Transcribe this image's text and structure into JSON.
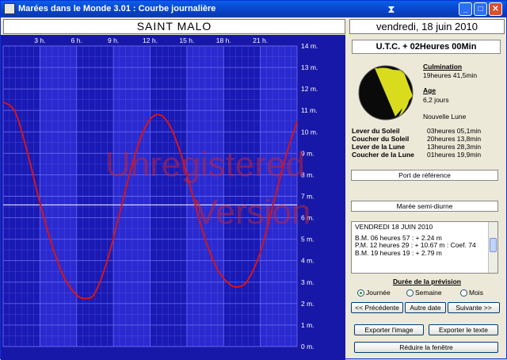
{
  "window": {
    "title": "Marées dans le Monde 3.01 : Courbe journalière",
    "minimize": "_",
    "maximize": "□",
    "close": "✕"
  },
  "header": {
    "city": "SAINT MALO",
    "date": "vendredi, 18 juin 2010"
  },
  "chart_data": {
    "type": "line",
    "x_ticks": [
      "3 h.",
      "6 h.",
      "9 h.",
      "12 h.",
      "15 h.",
      "18 h.",
      "21 h."
    ],
    "y_ticks": [
      "0 m.",
      "1 m.",
      "2 m.",
      "3 m.",
      "4 m.",
      "5 m.",
      "6 m.",
      "7 m.",
      "8 m.",
      "9 m.",
      "10 m.",
      "11 m.",
      "12 m.",
      "13 m.",
      "14 m."
    ],
    "xlim": [
      0,
      24
    ],
    "ylim": [
      0,
      14
    ],
    "current_level_m": 6.6,
    "grid": true,
    "series": [
      {
        "color": "#d81414",
        "x": [
          0,
          1,
          2,
          3,
          4,
          5,
          6,
          6.75,
          7.5,
          8.5,
          9.5,
          10.5,
          11.5,
          12.5,
          13.5,
          14.5,
          15.5,
          16.5,
          17.5,
          18.5,
          19.25,
          20,
          21,
          22,
          23,
          24
        ],
        "y": [
          11.4,
          10.9,
          9.0,
          6.7,
          4.7,
          3.2,
          2.4,
          2.24,
          2.5,
          4.0,
          6.2,
          8.4,
          10.1,
          10.8,
          10.4,
          9.0,
          7.0,
          5.0,
          3.6,
          2.9,
          2.79,
          3.1,
          4.4,
          6.5,
          8.7,
          10.5
        ]
      }
    ]
  },
  "watermark": {
    "line1": "Unregistered",
    "line2": "Version"
  },
  "sidebar": {
    "utc": "U.T.C. + 02Heures 00Min",
    "culmination_label": "Culmination",
    "culmination_value": "19heures 41,5min",
    "age_label": "Age",
    "age_value": "6,2 jours",
    "phase": "Nouvelle Lune",
    "ephemeris": [
      {
        "label": "Lever du Soleil",
        "value": "03heures 05,1min"
      },
      {
        "label": "Coucher du Soleil",
        "value": "20heures 13,8min"
      },
      {
        "label": "Lever de la Lune",
        "value": "13heures 28,3min"
      },
      {
        "label": "Coucher de la Lune",
        "value": "01heures 19,9min"
      }
    ],
    "port_ref": "Port de référence",
    "maree": "Marée semi-diurne",
    "tides_header": "VENDREDI 18 JUIN 2010",
    "tides": [
      "B.M. 06 heures 57 : + 2.24 m",
      "P.M. 12 heures 29 : + 10.67 m : Coef. 74",
      "B.M. 19 heures 19 : + 2.79 m"
    ],
    "duree_label": "Durée de la prévision",
    "radios": [
      {
        "label": "Journée",
        "checked": true
      },
      {
        "label": "Semaine",
        "checked": false
      },
      {
        "label": "Mois",
        "checked": false
      }
    ],
    "nav": {
      "prev": "<< Précédente",
      "other": "Autre date",
      "next": "Suivante >>"
    },
    "export_image": "Exporter l'image",
    "export_text": "Exporter le texte",
    "reduce": "Réduire la fenêtre"
  },
  "colors": {
    "chart_bg": "#1919b4",
    "chart_band": "#2a2ad0",
    "chart_grid": "#6c6cf2",
    "curve": "#d81414",
    "axis_text": "#ffffff",
    "watermark": "#c0243c"
  }
}
